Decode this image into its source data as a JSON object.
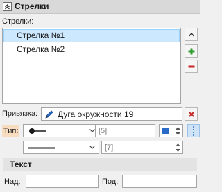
{
  "header": {
    "title": "Стрелки"
  },
  "arrows": {
    "label": "Стрелки:",
    "items": [
      "Стрелка №1",
      "Стрелка №2"
    ]
  },
  "binding": {
    "label": "Привязка:",
    "value": "Дуга окружности 19"
  },
  "type_row": {
    "label": "Тип:",
    "size_value": "[5]"
  },
  "line_row": {
    "size_value": "[7]"
  },
  "text_section": {
    "title": "Текст",
    "above_label": "Над:",
    "below_label": "Под:",
    "above_value": "",
    "below_value": ""
  },
  "colors": {
    "selection": "#cce8ff",
    "add": "#2e9b2e",
    "remove": "#c62828",
    "tip_highlight": "#f7dcc0",
    "accent_blue": "#2a6ac7"
  }
}
